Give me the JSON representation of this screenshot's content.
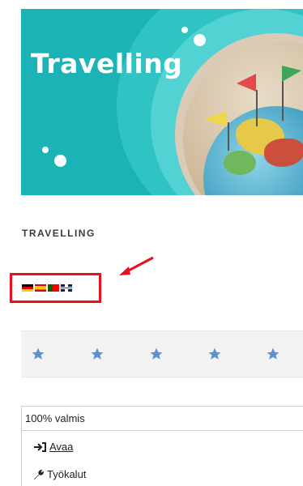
{
  "banner": {
    "title": "Travelling"
  },
  "course": {
    "title": "TRAVELLING"
  },
  "languages": {
    "flags": [
      "german-flag-icon",
      "spanish-flag-icon",
      "portuguese-flag-icon",
      "uk-flag-icon"
    ]
  },
  "rating": {
    "star_count": 5,
    "star_color": "#5b8fd1"
  },
  "progress": {
    "text": "100% valmis"
  },
  "actions": {
    "open_label": "Avaa",
    "tools_label": "Työkalut"
  },
  "colors": {
    "banner_teal": "#1bb3b5",
    "highlight_red": "#e8111b"
  }
}
